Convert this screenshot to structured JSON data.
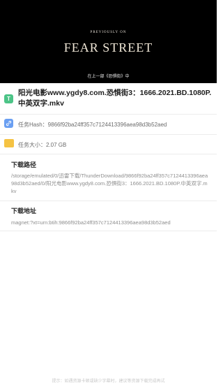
{
  "video": {
    "pre_title": "PREVIOUSLY ON",
    "title": "FEAR STREET",
    "subtitle": "在上一部《恐惧街》中"
  },
  "file": {
    "name": "阳光电影www.ygdy8.com.恐惧街3：1666.2021.BD.1080P.中英双字.mkv"
  },
  "task_hash": {
    "label": "任务Hash：9866f92ba24ff357c7124413396aea98d3b52aed"
  },
  "task_size": {
    "label": "任务大小：2.07 GB"
  },
  "download_path": {
    "title": "下载路径",
    "value": "/storage/emulated/0/迅雷下载/ThunderDownload/9866f92ba24ff357c7124413396aea98d3b52aed/0/阳光电影www.ygdy8.com.恐惧街3：1666.2021.BD.1080P.中英双字.mkv"
  },
  "download_url": {
    "title": "下载地址",
    "value": "magnet:?xt=urn:btih:9866f92ba24ff357c7124413396aea98d3b52aed"
  },
  "footer": {
    "text": "提示：如遇资源卡顿或缺少字幕时，建议等资源下载完成再试"
  }
}
